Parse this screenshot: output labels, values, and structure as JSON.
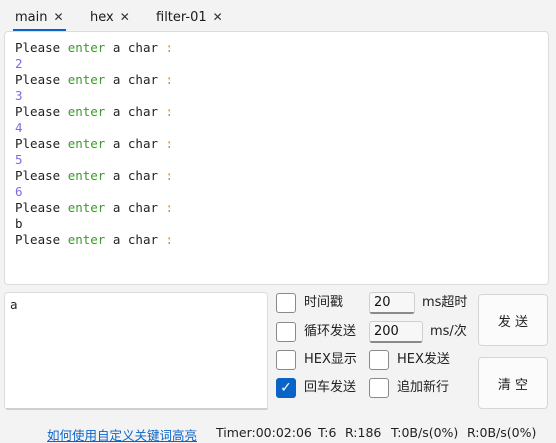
{
  "tabs": [
    {
      "label": "main",
      "close": "✕",
      "active": true
    },
    {
      "label": "hex",
      "close": "✕",
      "active": false
    },
    {
      "label": "filter-01",
      "close": "✕",
      "active": false
    }
  ],
  "receive": {
    "prompt": {
      "w1": "Please ",
      "w2": "enter",
      "w3": " a char ",
      "w4": ":"
    },
    "values": [
      "2",
      "3",
      "4",
      "5",
      "6",
      "b"
    ]
  },
  "send": {
    "text": "a"
  },
  "options": {
    "timestamp_label": "时间戳",
    "timeout_value": "20",
    "timeout_unit": "ms超时",
    "loop_label": "循环发送",
    "loop_value": "200",
    "loop_unit": "ms/次",
    "hex_display_label": "HEX显示",
    "hex_send_label": "HEX发送",
    "enter_send_label": "回车发送",
    "append_newline_label": "追加新行",
    "check_mark": "✓"
  },
  "buttons": {
    "send": "发 送",
    "clear": "清 空"
  },
  "status": {
    "help_link": "如何使用自定义关键词高亮",
    "timer": "Timer:00:02:06",
    "t": "T:6",
    "r": "R:186",
    "tx_rate": "T:0B/s(0%)",
    "rx_rate": "R:0B/s(0%)"
  },
  "colors": {
    "accent": "#0a64c8",
    "keyword_green": "#3a9a2a",
    "keyword_orange": "#e08a2c",
    "number": "#7f6be0"
  }
}
